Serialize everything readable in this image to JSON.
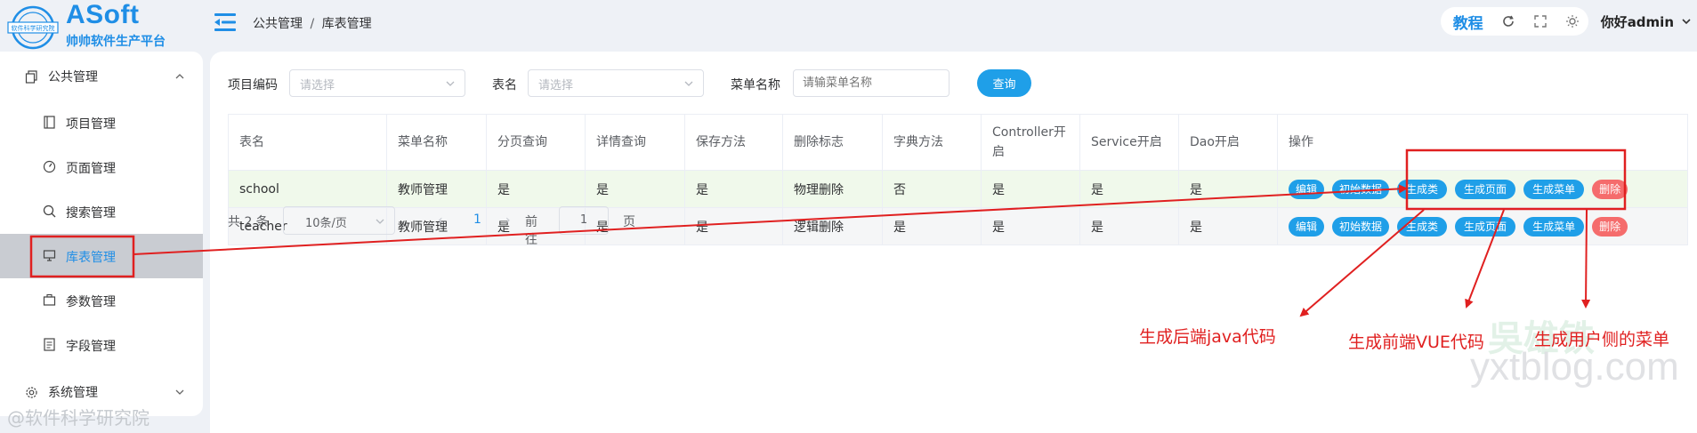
{
  "header": {
    "logo_title": "ASoft",
    "logo_subtitle": "帅帅软件生产平台",
    "logo_seal_text": "软件科学研究院",
    "breadcrumb": [
      "公共管理",
      "库表管理"
    ],
    "breadcrumb_sep": "/",
    "tutorial_label": "教程",
    "user_greeting": "你好admin"
  },
  "sidebar": {
    "group_public": "公共管理",
    "items": [
      {
        "label": "项目管理",
        "icon": "book-icon"
      },
      {
        "label": "页面管理",
        "icon": "dashboard-icon"
      },
      {
        "label": "搜索管理",
        "icon": "search-icon"
      },
      {
        "label": "库表管理",
        "icon": "monitor-icon"
      },
      {
        "label": "参数管理",
        "icon": "briefcase-icon"
      },
      {
        "label": "字段管理",
        "icon": "document-icon"
      }
    ],
    "group_system": "系统管理",
    "watermark": "@软件科学研究院"
  },
  "search": {
    "project_code_label": "项目编码",
    "project_code_placeholder": "请选择",
    "table_name_label": "表名",
    "table_name_placeholder": "请选择",
    "menu_name_label": "菜单名称",
    "menu_name_placeholder": "请输菜单名称",
    "query_button": "查询"
  },
  "table": {
    "columns": [
      "表名",
      "菜单名称",
      "分页查询",
      "详情查询",
      "保存方法",
      "删除标志",
      "字典方法",
      "Controller开启",
      "Service开启",
      "Dao开启",
      "操作"
    ],
    "rows": [
      [
        "school",
        "教师管理",
        "是",
        "是",
        "是",
        "物理删除",
        "否",
        "是",
        "是",
        "是"
      ],
      [
        "teacher",
        "教师管理",
        "是",
        "是",
        "是",
        "逻辑删除",
        "是",
        "是",
        "是",
        "是"
      ]
    ],
    "actions": {
      "edit": "编辑",
      "init_data": "初始数据",
      "gen_class": "生成类",
      "gen_page": "生成页面",
      "gen_menu": "生成菜单",
      "delete": "删除"
    }
  },
  "pagination": {
    "total": "共 2 条",
    "page_size": "10条/页",
    "current_page": "1",
    "goto_label": "前往",
    "goto_value": "1",
    "page_unit": "页"
  },
  "annotations": {
    "backend": "生成后端java代码",
    "frontend": "生成前端VUE代码",
    "menu": "生成用户侧的菜单",
    "color": "#e02020"
  },
  "watermark_right": "yxtblog.com",
  "watermark_right_cn": "吳雄铁",
  "colors": {
    "primary": "#1f9fe8",
    "danger": "#f56c6c",
    "highlight_row": "#f0f9eb",
    "active_menu_bg": "#c9ccd2"
  }
}
